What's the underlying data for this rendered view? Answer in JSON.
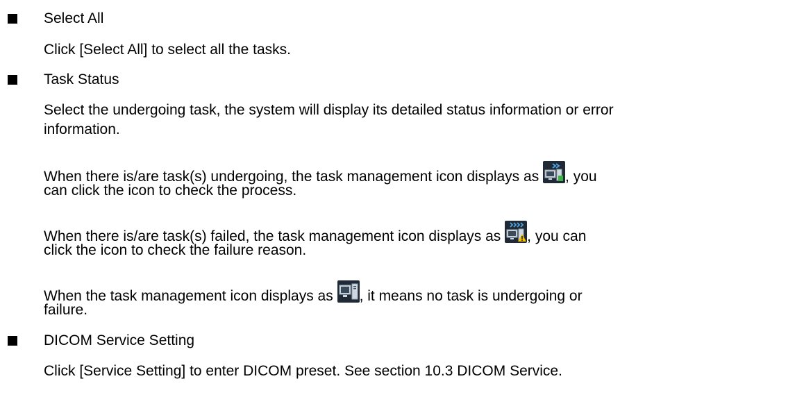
{
  "sections": [
    {
      "heading": "Select All",
      "lines": [
        "Click [Select All] to select all the tasks."
      ]
    },
    {
      "heading": "Task Status",
      "para1_line1": "Select the undergoing task, the system will display its detailed status information or error",
      "para1_line2": "information.",
      "para2_line1_before": "When there is/are task(s) undergoing, the task management icon displays as ",
      "para2_line1_after": ", you",
      "para2_line2": "can click the icon to check the process.",
      "para3_line1_before": "When there is/are task(s) failed, the task management icon displays as ",
      "para3_line1_after": ", you can",
      "para3_line2": "click the icon to check the failure reason.",
      "para4_line1_before": "When the task management icon displays as ",
      "para4_line1_after": ", it means no task is undergoing or",
      "para4_line2": "failure."
    },
    {
      "heading": "DICOM Service Setting",
      "lines": [
        "Click [Service Setting] to enter DICOM preset. See section 10.3 DICOM Service."
      ]
    }
  ],
  "icons": {
    "undergoing": "task-undergoing-icon",
    "failed": "task-failed-icon",
    "idle": "task-idle-icon"
  },
  "colors": {
    "text": "#000000",
    "icon_bg": "#1f2a36",
    "icon_arrow": "#4fa3e0",
    "icon_ok": "#3cb043",
    "icon_warn": "#f2c200"
  }
}
